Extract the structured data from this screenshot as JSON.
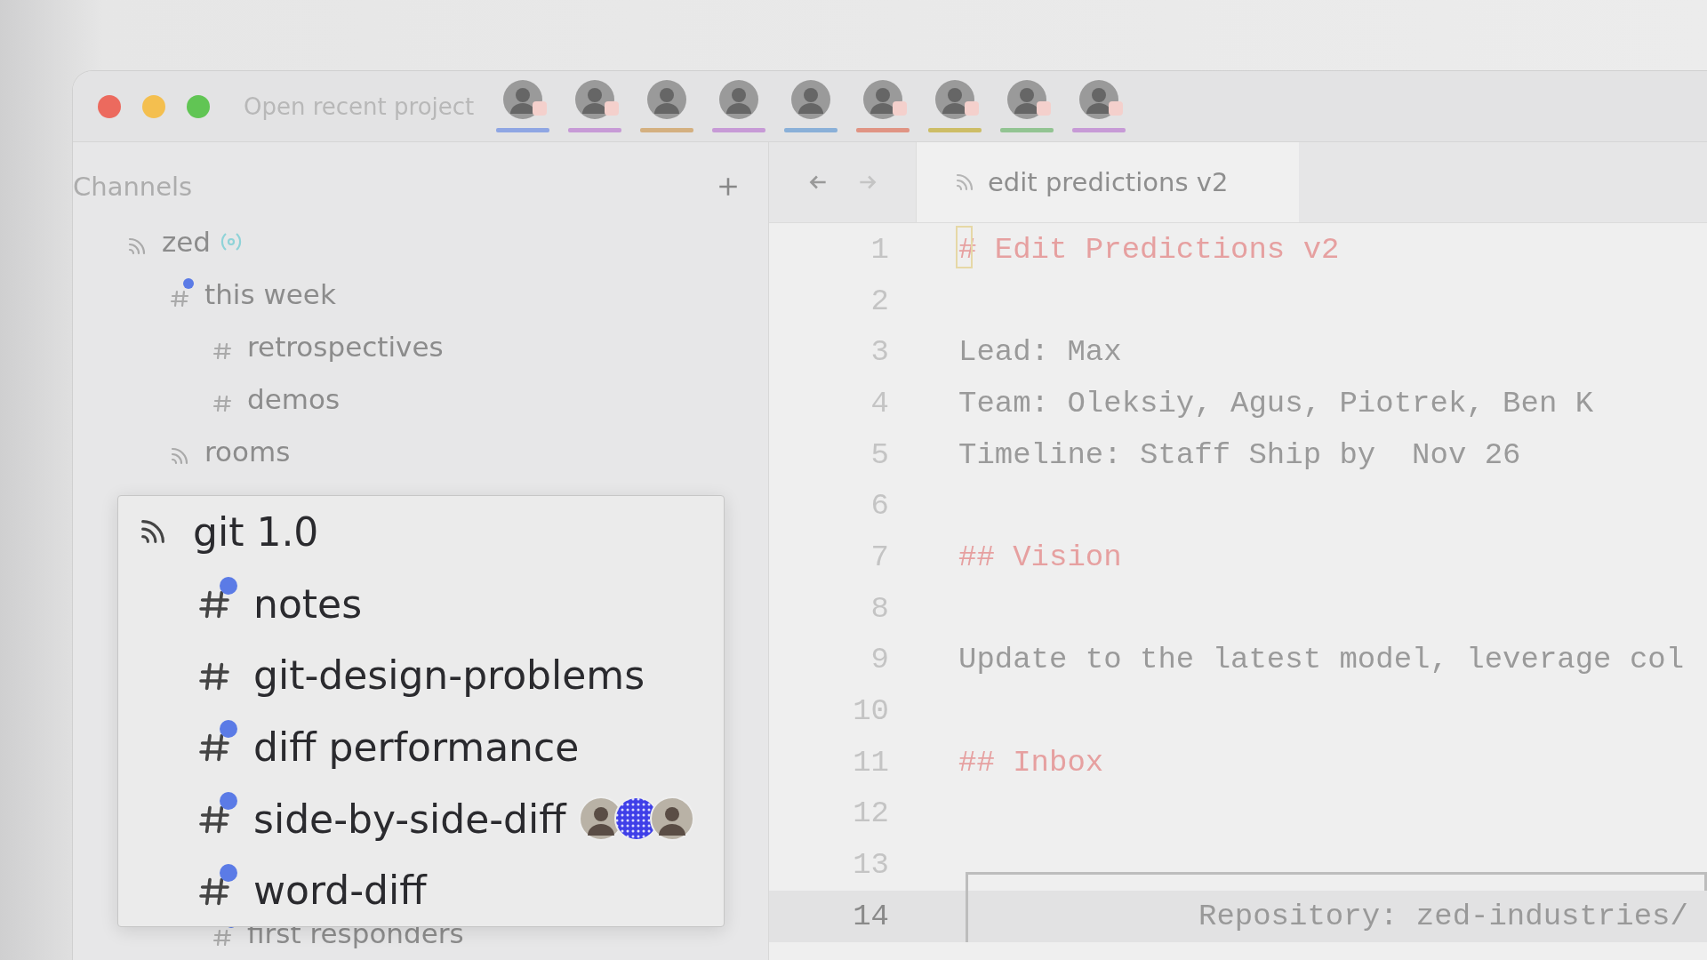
{
  "titlebar": {
    "project_button": "Open recent project",
    "collaborators": [
      {
        "color": "#8fa6e3",
        "muted": true
      },
      {
        "color": "#c79ad6",
        "muted": true
      },
      {
        "color": "#d4b080",
        "muted": false
      },
      {
        "color": "#c79ad6",
        "muted": false
      },
      {
        "color": "#8ab0d8",
        "muted": false
      },
      {
        "color": "#e09484",
        "muted": true
      },
      {
        "color": "#cdbd66",
        "muted": true
      },
      {
        "color": "#92c492",
        "muted": true
      },
      {
        "color": "#c79ad6",
        "muted": true
      }
    ]
  },
  "sidebar": {
    "title": "Channels",
    "channels": [
      {
        "name": "zed",
        "kind": "group",
        "live": true,
        "unread": false,
        "children": [
          {
            "name": "this week",
            "kind": "channel",
            "live": false,
            "unread": true,
            "children": [
              {
                "name": "retrospectives",
                "kind": "channel",
                "live": false,
                "unread": false
              },
              {
                "name": "demos",
                "kind": "channel",
                "live": false,
                "unread": false
              }
            ]
          },
          {
            "name": "rooms",
            "kind": "group",
            "live": false,
            "unread": false
          }
        ]
      }
    ],
    "channels_below_popover": [
      {
        "name": "first responders",
        "kind": "channel",
        "live": false,
        "unread": true
      }
    ]
  },
  "popover": {
    "title": "git 1.0",
    "channels": [
      {
        "name": "notes",
        "unread": true
      },
      {
        "name": "git-design-problems",
        "unread": false
      },
      {
        "name": "diff performance",
        "unread": true
      },
      {
        "name": "side-by-side-diff",
        "unread": true,
        "participants": [
          {
            "kind": "photo"
          },
          {
            "kind": "pattern"
          },
          {
            "kind": "photo"
          }
        ]
      },
      {
        "name": "word-diff",
        "unread": true
      }
    ]
  },
  "editor": {
    "tab": "edit predictions v2",
    "lines": [
      {
        "number": "1",
        "kind": "heading",
        "text": "# Edit Predictions v2",
        "cursor": true,
        "current": false
      },
      {
        "number": "2",
        "kind": "blank",
        "cursor": false,
        "current": false
      },
      {
        "number": "3",
        "kind": "text",
        "text": "Lead: Max",
        "cursor": false,
        "current": false
      },
      {
        "number": "4",
        "kind": "text",
        "text": "Team: Oleksiy, Agus, Piotrek, Ben K",
        "cursor": false,
        "current": false
      },
      {
        "number": "5",
        "kind": "text",
        "text": "Timeline: Staff Ship by  Nov 26",
        "cursor": false,
        "current": false
      },
      {
        "number": "6",
        "kind": "blank",
        "cursor": false,
        "current": false
      },
      {
        "number": "7",
        "kind": "heading",
        "text": "## Vision",
        "cursor": false,
        "current": false
      },
      {
        "number": "8",
        "kind": "blank",
        "cursor": false,
        "current": false
      },
      {
        "number": "9",
        "kind": "text",
        "text": "Update to the latest model, leverage col",
        "cursor": false,
        "current": false
      },
      {
        "number": "10",
        "kind": "blank",
        "cursor": false,
        "current": false
      },
      {
        "number": "11",
        "kind": "heading",
        "text": "## Inbox",
        "cursor": false,
        "current": false
      },
      {
        "number": "12",
        "kind": "blank",
        "cursor": false,
        "current": false
      },
      {
        "number": "13",
        "kind": "box_top",
        "cursor": false,
        "current": false
      },
      {
        "number": "14",
        "kind": "box_row",
        "text": "Repository: zed-industries/",
        "cursor": false,
        "current": true
      }
    ]
  }
}
